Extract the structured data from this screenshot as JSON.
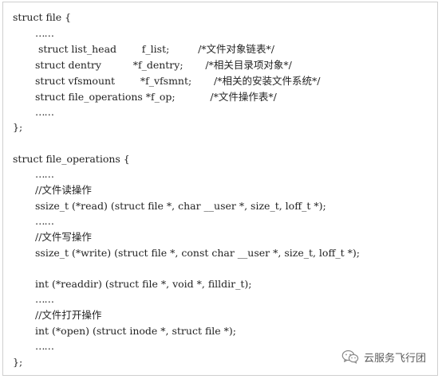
{
  "code": {
    "file_struct_open": "struct file {",
    "file_ellipsis_1": "……",
    "file_f_list": " struct list_head        f_list;         /*文件对象链表*/",
    "file_f_dentry": "struct dentry          *f_dentry;       /*相关目录项对象*/",
    "file_f_vfsmnt": "struct vfsmount        *f_vfsmnt;       /*相关的安装文件系统*/",
    "file_f_op": "struct file_operations *f_op;           /*文件操作表*/",
    "file_ellipsis_2": "……",
    "file_struct_close": "};",
    "fops_struct_open": "struct file_operations {",
    "fops_ellipsis_1": "……",
    "fops_read_comment": "//文件读操作",
    "fops_read_sig": "ssize_t (*read) (struct file *, char __user *, size_t, loff_t *);",
    "fops_ellipsis_2": "……",
    "fops_write_comment": "//文件写操作",
    "fops_write_sig": "ssize_t (*write) (struct file *, const char __user *, size_t, loff_t *);",
    "fops_readdir_sig": "int (*readdir) (struct file *, void *, filldir_t);",
    "fops_ellipsis_3": "……",
    "fops_open_comment": "//文件打开操作",
    "fops_open_sig": "int (*open) (struct inode *, struct file *);",
    "fops_ellipsis_4": "……",
    "fops_struct_close": "};"
  },
  "watermark": {
    "icon": "wechat-icon",
    "text": "云服务飞行团"
  }
}
